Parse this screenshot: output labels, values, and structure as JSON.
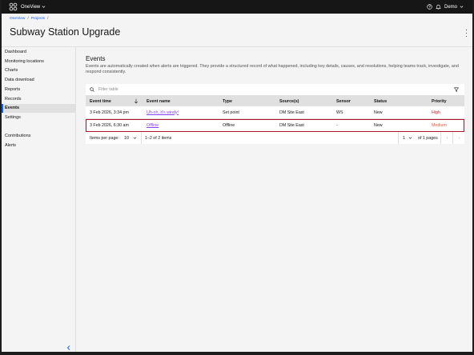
{
  "app": {
    "name": "OneView",
    "user": "Demo"
  },
  "breadcrumb": [
    {
      "label": "OneView"
    },
    {
      "label": "Projects"
    }
  ],
  "breadcrumb_sep": "/",
  "page_title": "Subway Station Upgrade",
  "sidebar": {
    "items": [
      {
        "label": "Dashboard"
      },
      {
        "label": "Monitoring locations"
      },
      {
        "label": "Charts"
      },
      {
        "label": "Data download"
      },
      {
        "label": "Reports"
      },
      {
        "label": "Records"
      },
      {
        "label": "Events"
      },
      {
        "label": "Settings"
      }
    ],
    "secondary": [
      {
        "label": "Contributions"
      },
      {
        "label": "Alerts"
      }
    ]
  },
  "events": {
    "heading": "Events",
    "description": "Events are automatically created when alerts are triggered. They provide a structured record of what happened, including key details, causes, and resolutions, helping teams track, investigate, and respond consistently.",
    "filter_placeholder": "Filter table",
    "columns": [
      "Event time",
      "Event name",
      "Type",
      "Source(s)",
      "Sensor",
      "Status",
      "Priority"
    ],
    "rows": [
      {
        "time": "3 Feb 2026, 3:34 pm",
        "name": "Uh-oh, it's windy!",
        "type": "Set point",
        "source": "DM Site East",
        "sensor": "WS",
        "status": "New",
        "priority": "High"
      },
      {
        "time": "3 Feb 2026, 6:30 am",
        "name": "Offline",
        "type": "Offline",
        "source": "DM Site East",
        "sensor": "-",
        "status": "New",
        "priority": "Medium"
      }
    ],
    "pagination": {
      "items_per_page_label": "Items per page:",
      "items_per_page": "10",
      "range": "1–2 of 2 items",
      "page": "1",
      "of_pages": "of 1 pages"
    }
  },
  "icons": [
    "oneview-logo-icon",
    "chevron-down-icon",
    "help-icon",
    "bell-icon",
    "overflow-menu-icon",
    "search-icon",
    "filter-icon",
    "sort-arrow-icon",
    "chevron-left-icon",
    "caret-left-icon",
    "caret-right-icon"
  ],
  "colors": {
    "topbar": "#161616",
    "link": "#0f62fe",
    "event_link": "#8a3ffc",
    "priority_high": "#da1e28",
    "priority_medium": "#e8593b",
    "highlight_border": "#b1102a",
    "selected_nav": "#0f62fe"
  }
}
